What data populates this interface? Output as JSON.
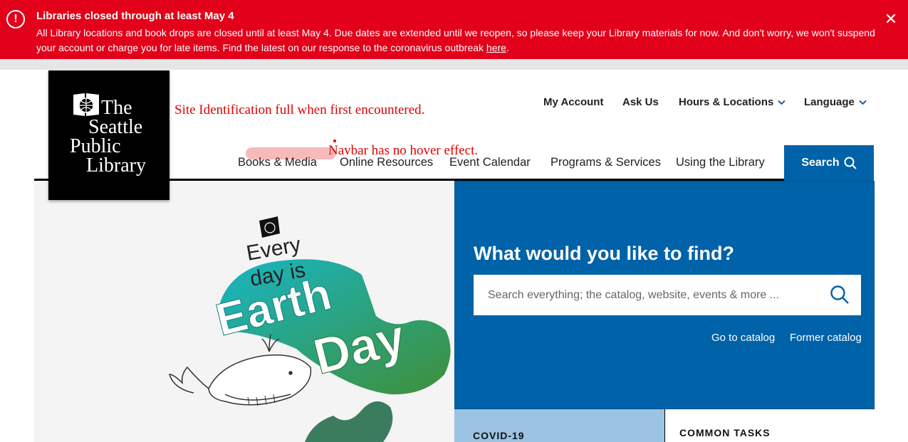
{
  "alert": {
    "title": "Libraries closed through at least May 4",
    "body": "All Library locations and book drops are closed until at least May 4. Due dates are extended until we reopen, so please keep your Library materials for now. And don't worry, we won't suspend your account or charge you for late items. Find the latest on our response to the coronavirus outbreak ",
    "link": "here",
    "period": ".",
    "icon": "exclamation-icon",
    "close_icon": "close-icon",
    "color": "#e2001a"
  },
  "logo": {
    "lines": [
      "The",
      "Seattle",
      "Public",
      "Library"
    ]
  },
  "annotations": {
    "site_id": "Site Identification full when first encountered.",
    "navbar": "Navbar has no hover effect."
  },
  "utility_nav": {
    "my_account": "My Account",
    "ask_us": "Ask Us",
    "hours": "Hours & Locations",
    "language": "Language"
  },
  "main_nav": {
    "books": "Books & Media",
    "online": "Online Resources",
    "events": "Event Calendar",
    "programs": "Programs & Services",
    "using": "Using the Library",
    "search": "Search"
  },
  "hero": {
    "art": {
      "line1": "Every",
      "line2": "day is",
      "line3": "Earth",
      "line4": "Day"
    },
    "find_title": "What would you like to find?",
    "search_placeholder": "Search everything; the catalog, website, events & more ...",
    "go_to_catalog": "Go to catalog",
    "former_catalog": "Former catalog"
  },
  "sections": {
    "covid": "COVID-19",
    "common_tasks": "COMMON TASKS"
  },
  "colors": {
    "brand_blue": "#0062a8",
    "light_blue": "#9bc4e2",
    "annotation_red": "#e00000"
  }
}
